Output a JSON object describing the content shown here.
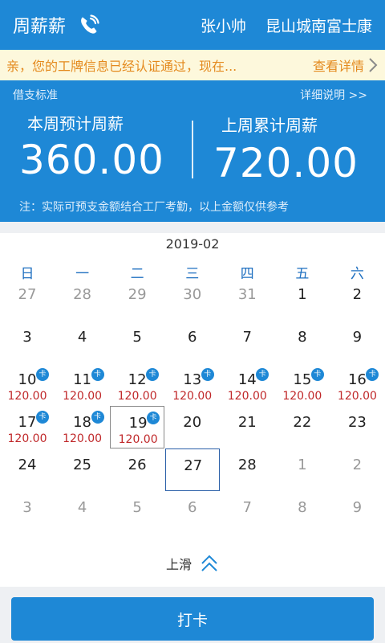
{
  "header": {
    "title": "周薪薪",
    "user_name": "张小帅",
    "factory": "昆山城南富士康"
  },
  "notice": {
    "message": "亲，您的工牌信息已经认证通过，现在...",
    "link": "查看详情"
  },
  "summary": {
    "loan_standard": "借支标准",
    "detail_link": "详细说明 >>",
    "this_week_label": "本周预计周薪",
    "this_week_value": "360.00",
    "last_week_label": "上周累计周薪",
    "last_week_value": "720.00",
    "note": "注：实际可预支金额结合工厂考勤，以上金额仅供参考"
  },
  "calendar": {
    "month": "2019-02",
    "weekdays": [
      "日",
      "一",
      "二",
      "三",
      "四",
      "五",
      "六"
    ],
    "rows": [
      [
        {
          "day": "27",
          "other": true
        },
        {
          "day": "28",
          "other": true
        },
        {
          "day": "29",
          "other": true
        },
        {
          "day": "30",
          "other": true
        },
        {
          "day": "31",
          "other": true
        },
        {
          "day": "1"
        },
        {
          "day": "2"
        }
      ],
      [
        {
          "day": "3"
        },
        {
          "day": "4"
        },
        {
          "day": "5"
        },
        {
          "day": "6"
        },
        {
          "day": "7"
        },
        {
          "day": "8"
        },
        {
          "day": "9"
        }
      ],
      [
        {
          "day": "10",
          "badge": "卡",
          "amount": "120.00"
        },
        {
          "day": "11",
          "badge": "卡",
          "amount": "120.00"
        },
        {
          "day": "12",
          "badge": "卡",
          "amount": "120.00"
        },
        {
          "day": "13",
          "badge": "卡",
          "amount": "120.00"
        },
        {
          "day": "14",
          "badge": "卡",
          "amount": "120.00"
        },
        {
          "day": "15",
          "badge": "卡",
          "amount": "120.00"
        },
        {
          "day": "16",
          "badge": "卡",
          "amount": "120.00"
        }
      ],
      [
        {
          "day": "17",
          "badge": "卡",
          "amount": "120.00"
        },
        {
          "day": "18",
          "badge": "卡",
          "amount": "120.00"
        },
        {
          "day": "19",
          "badge": "卡",
          "amount": "120.00",
          "selected": true
        },
        {
          "day": "20"
        },
        {
          "day": "21"
        },
        {
          "day": "22"
        },
        {
          "day": "23"
        }
      ],
      [
        {
          "day": "24"
        },
        {
          "day": "25"
        },
        {
          "day": "26"
        },
        {
          "day": "27",
          "today": true
        },
        {
          "day": "28"
        },
        {
          "day": "1",
          "other": true
        },
        {
          "day": "2",
          "other": true
        }
      ],
      [
        {
          "day": "3",
          "other": true
        },
        {
          "day": "4",
          "other": true
        },
        {
          "day": "5",
          "other": true
        },
        {
          "day": "6",
          "other": true
        },
        {
          "day": "7",
          "other": true
        },
        {
          "day": "8",
          "other": true
        },
        {
          "day": "9",
          "other": true
        }
      ]
    ]
  },
  "swipe": {
    "label": "上滑",
    "icon": "double-chevron-up-icon"
  },
  "footer": {
    "punch_label": "打卡"
  },
  "icons": {
    "phone": "phone-icon",
    "notice_arrow": "chevron-right-icon"
  },
  "colors": {
    "primary": "#1e88d6",
    "notice_bg": "#fdf8dc",
    "notice_text": "#e48a1e",
    "amount": "#c0282a",
    "weekday": "#1e6fc0",
    "today_border": "#2a5fa8"
  }
}
